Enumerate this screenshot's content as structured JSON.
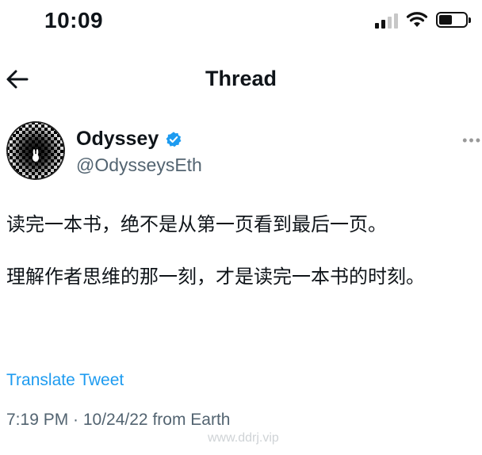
{
  "status_bar": {
    "time": "10:09",
    "signal_icon": "cellular-signal-icon",
    "wifi_icon": "wifi-icon",
    "battery_icon": "battery-icon",
    "battery_level": 0.5
  },
  "nav": {
    "back_icon": "arrow-left-icon",
    "title": "Thread"
  },
  "author": {
    "display_name": "Odyssey",
    "handle": "@OdysseysEth",
    "verified_icon": "verified-badge-icon",
    "verified_color": "#1d9bf0",
    "more_icon": "more-options-icon"
  },
  "tweet": {
    "paragraph_1": "读完一本书，绝不是从第一页看到最后一页。",
    "paragraph_2": "理解作者思维的那一刻，才是读完一本书的时刻。",
    "translate_label": "Translate Tweet",
    "timestamp": "7:19 PM · 10/24/22 from Earth"
  },
  "watermark": "www.ddrj.vip",
  "colors": {
    "text": "#0f1419",
    "secondary": "#536471",
    "accent": "#1d9bf0"
  }
}
